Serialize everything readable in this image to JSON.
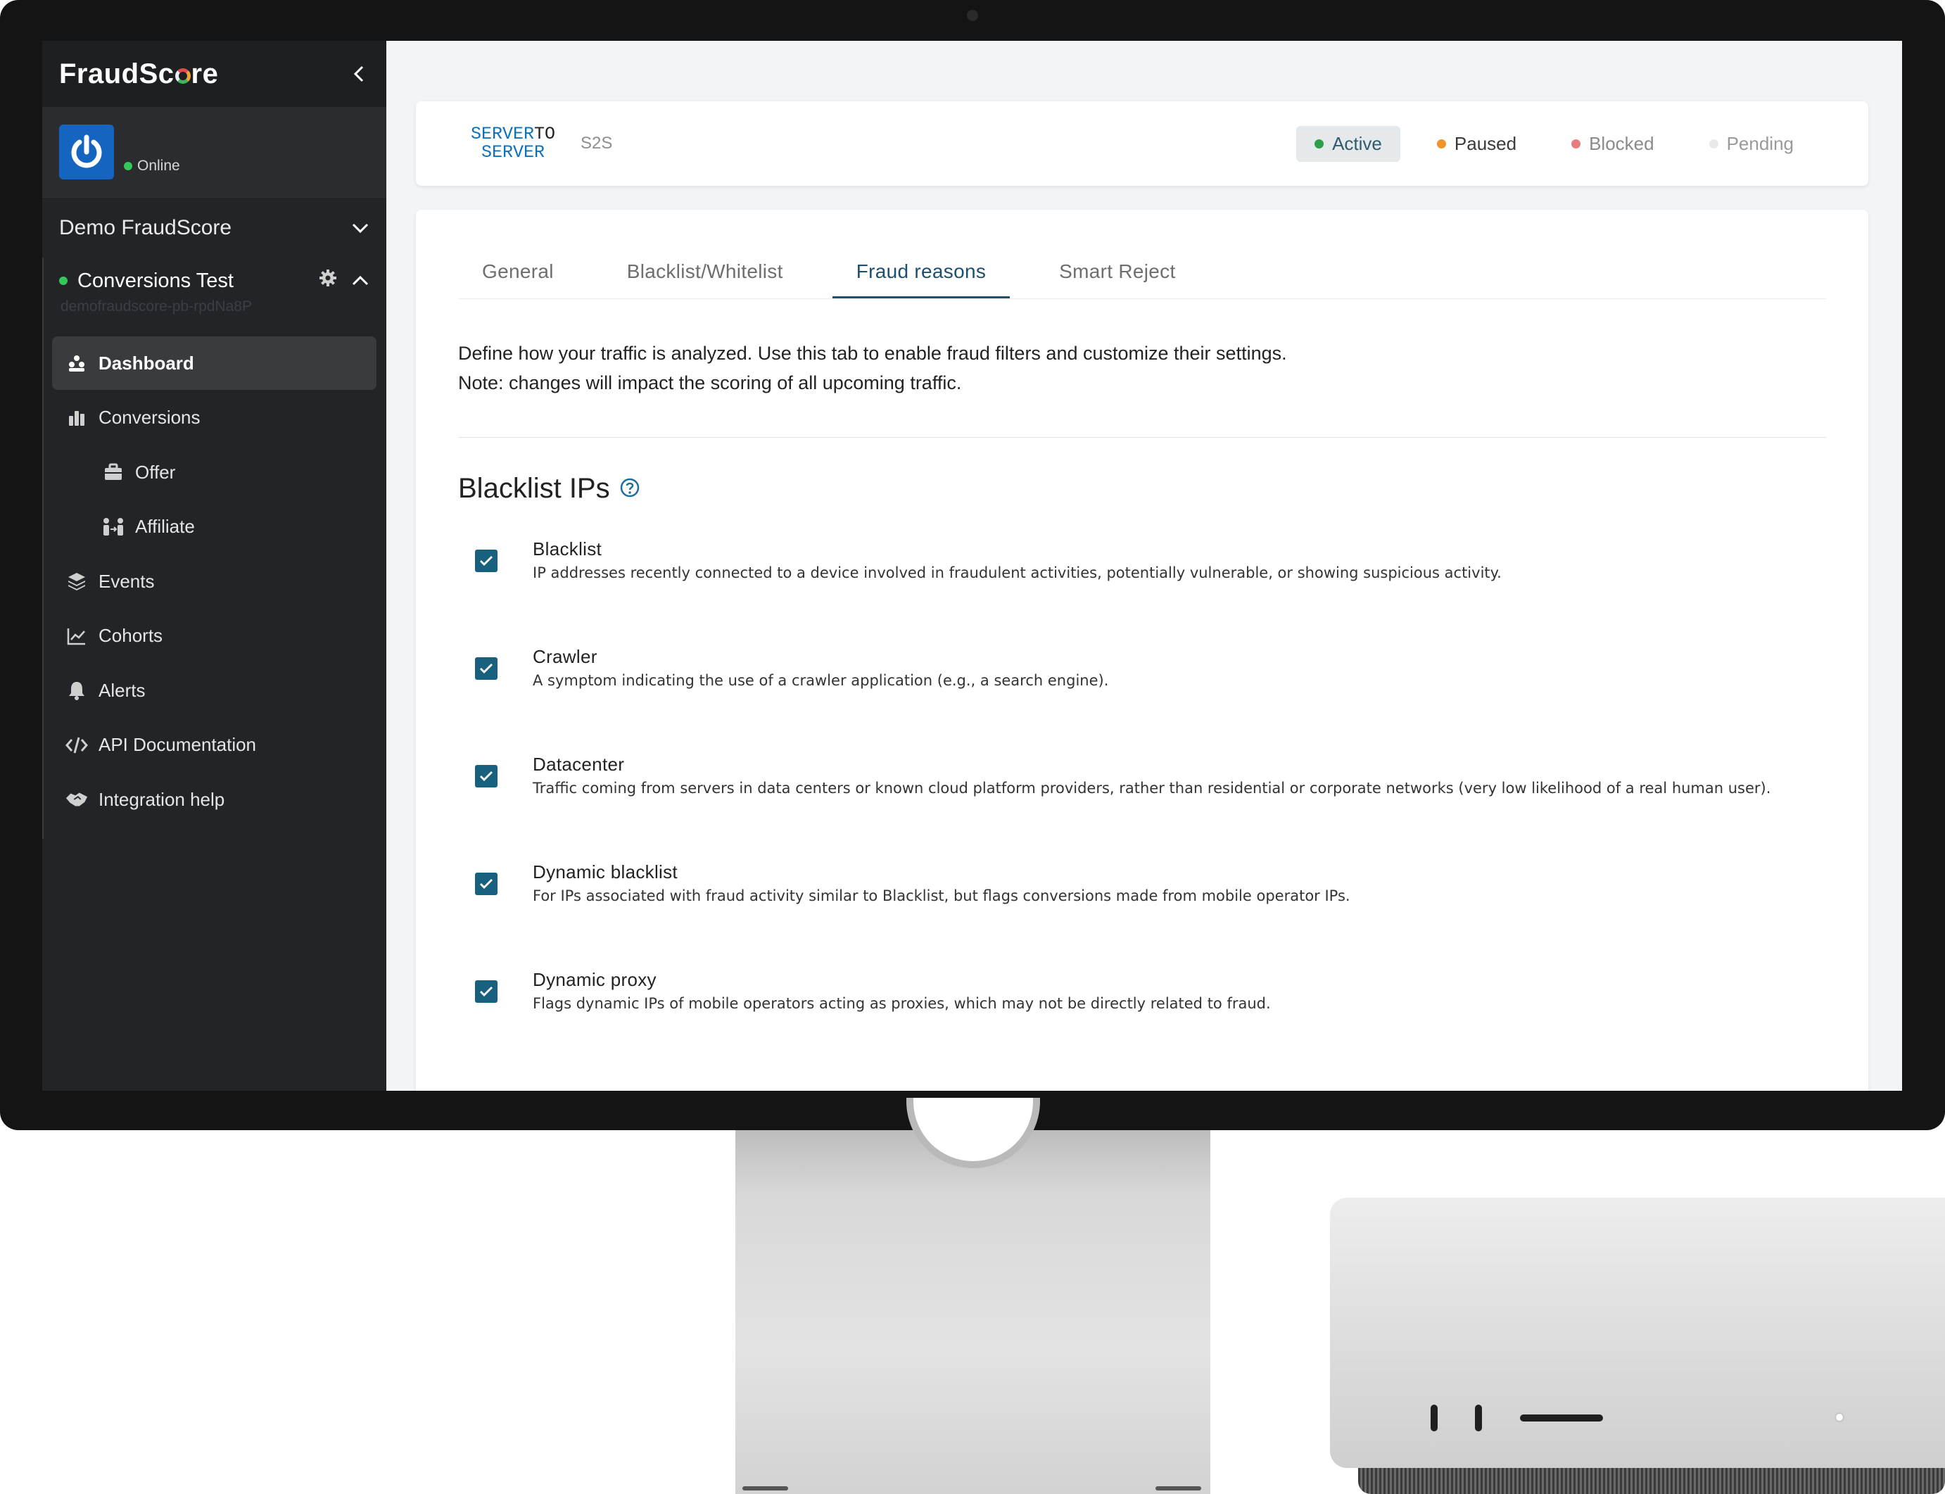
{
  "sidebar": {
    "logo_text": "FraudScore",
    "status_label": "Online",
    "org_name": "Demo FraudScore",
    "project_name": "Conversions Test",
    "project_id": "demofraudscore-pb-rpdNa8P",
    "nav": [
      {
        "label": "Dashboard",
        "icon": "dashboard-icon"
      },
      {
        "label": "Conversions",
        "icon": "bar-chart-icon"
      },
      {
        "label": "Offer",
        "icon": "briefcase-icon"
      },
      {
        "label": "Affiliate",
        "icon": "people-icon"
      },
      {
        "label": "Events",
        "icon": "layers-icon"
      },
      {
        "label": "Cohorts",
        "icon": "line-chart-icon"
      },
      {
        "label": "Alerts",
        "icon": "bell-icon"
      },
      {
        "label": "API Documentation",
        "icon": "code-icon"
      },
      {
        "label": "Integration help",
        "icon": "handshake-icon"
      }
    ]
  },
  "header": {
    "logo_line1": "SERVER",
    "logo_to": "TO",
    "logo_line2": "SERVER",
    "type_label": "S2S",
    "statuses": [
      {
        "label": "Active",
        "color": "#2e9e4a"
      },
      {
        "label": "Paused",
        "color": "#f0932b"
      },
      {
        "label": "Blocked",
        "color": "#e77c7c"
      },
      {
        "label": "Pending",
        "color": "#e9e9e9"
      }
    ]
  },
  "tabs": [
    "General",
    "Blacklist/Whitelist",
    "Fraud reasons",
    "Smart Reject"
  ],
  "intro": {
    "line1": "Define how your traffic is analyzed. Use this tab to enable fraud filters and customize their settings.",
    "line2": "Note: changes will impact the scoring of all upcoming traffic."
  },
  "section": {
    "title": "Blacklist IPs",
    "rules": [
      {
        "title": "Blacklist",
        "description": "IP addresses recently connected to a device involved in fraudulent activities, potentially vulnerable, or showing suspicious activity.",
        "checked": true
      },
      {
        "title": "Crawler",
        "description": "A symptom indicating the use of a crawler application (e.g., a search engine).",
        "checked": true
      },
      {
        "title": "Datacenter",
        "description": "Traffic coming from servers in data centers or known cloud platform providers, rather than residential or corporate networks (very low likelihood of a real human user).",
        "checked": true
      },
      {
        "title": "Dynamic blacklist",
        "description": "For IPs associated with fraud activity similar to Blacklist, but flags conversions made from mobile operator IPs.",
        "checked": true
      },
      {
        "title": "Dynamic proxy",
        "description": "Flags dynamic IPs of mobile operators acting as proxies, which may not be directly related to fraud.",
        "checked": true
      }
    ]
  },
  "colors": {
    "accent": "#17607e",
    "sidebar_bg": "#232427",
    "s2s_blue": "#0d71bb"
  }
}
